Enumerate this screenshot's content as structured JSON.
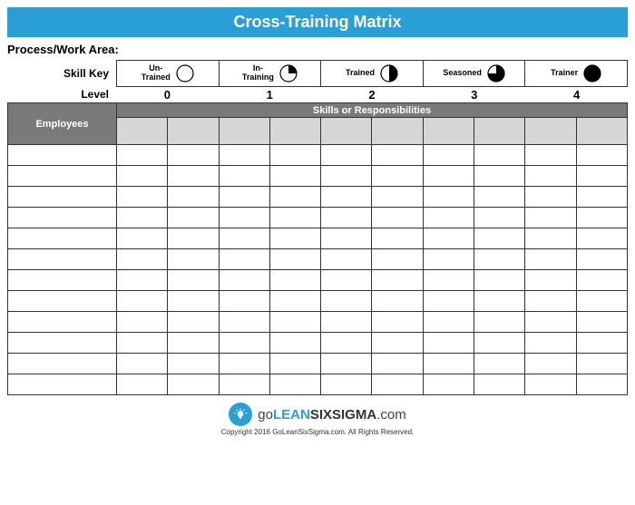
{
  "title": "Cross-Training Matrix",
  "work_area_label": "Process/Work Area:",
  "skill_key_label": "Skill Key",
  "level_label": "Level",
  "key": [
    {
      "label": "Un-Trained",
      "level": "0",
      "fill": 0
    },
    {
      "label": "In-Training",
      "level": "1",
      "fill": 1
    },
    {
      "label": "Trained",
      "level": "2",
      "fill": 2
    },
    {
      "label": "Seasoned",
      "level": "3",
      "fill": 3
    },
    {
      "label": "Trainer",
      "level": "4",
      "fill": 4
    }
  ],
  "table": {
    "employees_header": "Employees",
    "skills_header": "Skills or Responsibilities",
    "skill_columns": 10,
    "employee_rows": 12
  },
  "logo": {
    "pre": "go",
    "lean": "LEAN",
    "six": "SIXSIGMA",
    "suffix": ".com"
  },
  "copyright": "Copyright 2016 GoLeanSixSigma.com. All Rights Reserved."
}
